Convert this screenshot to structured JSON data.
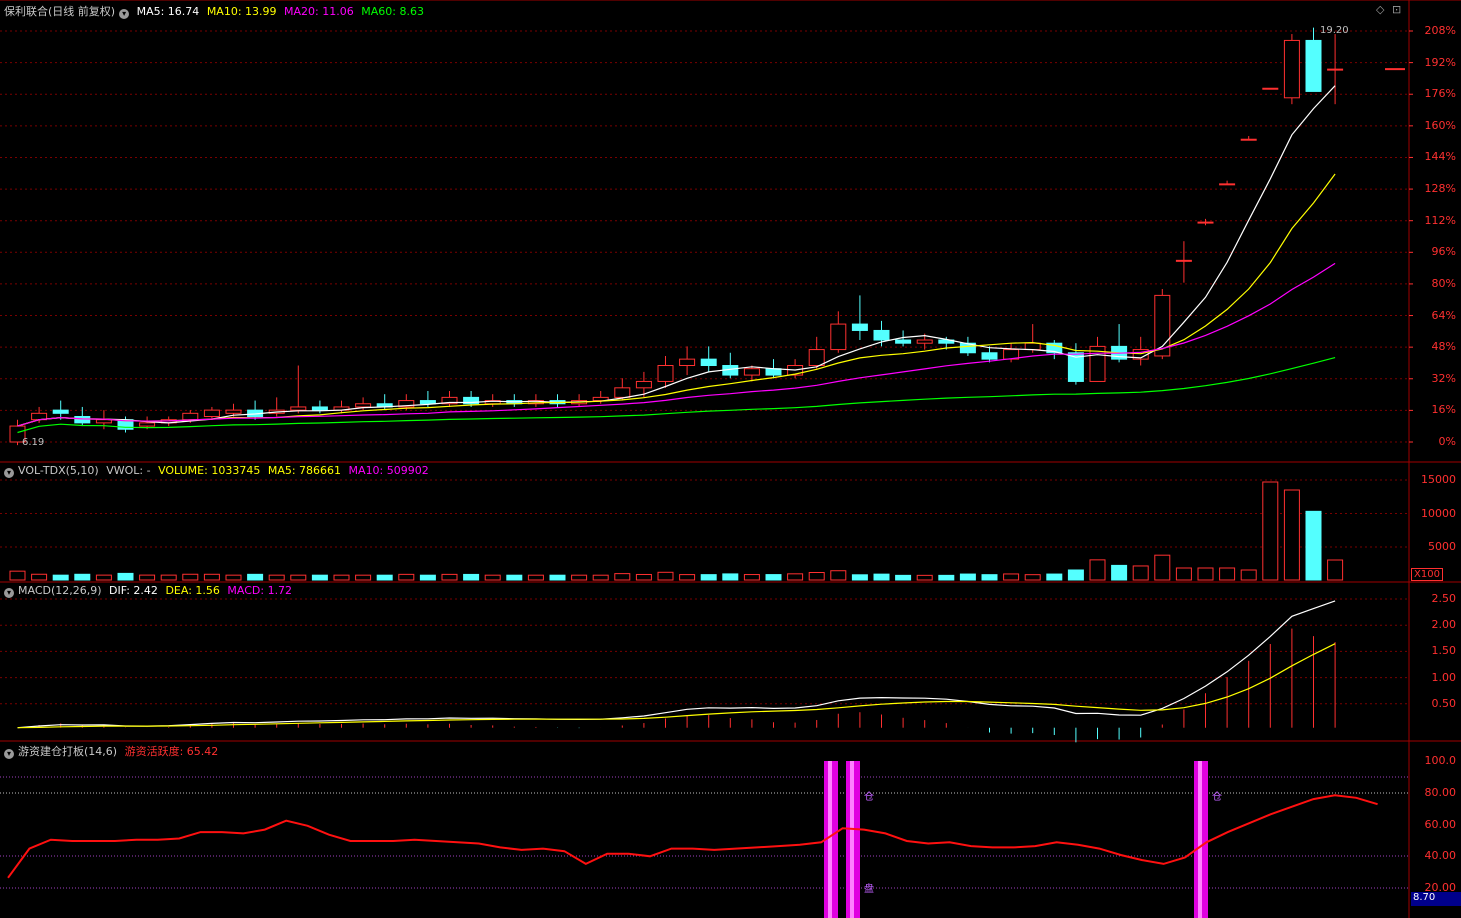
{
  "header": {
    "title": "保利联合(日线 前复权)",
    "ma_items": [
      {
        "label": "MA5: 16.74",
        "color": "#ffffff"
      },
      {
        "label": "MA10: 13.99",
        "color": "#ffff00"
      },
      {
        "label": "MA20: 11.06",
        "color": "#ff00ff"
      },
      {
        "label": "MA60: 8.63",
        "color": "#00ff00"
      }
    ],
    "ctl_icons": [
      "◇",
      "⊡"
    ]
  },
  "price_axis": [
    "208%",
    "192%",
    "176%",
    "160%",
    "144%",
    "128%",
    "112%",
    "96%",
    "80%",
    "64%",
    "48%",
    "32%",
    "16%",
    "0%"
  ],
  "price_marks": {
    "high": "19.20",
    "low": "6.19"
  },
  "volume": {
    "title": "VOL-TDX(5,10)",
    "vwol": "VWOL: -",
    "volume_label": "VOLUME: 1033745",
    "ma5_label": "MA5: 786661",
    "ma10_label": "MA10: 509902",
    "axis": [
      "15000",
      "10000",
      "5000"
    ],
    "unit": "X100"
  },
  "macd": {
    "title": "MACD(12,26,9)",
    "dif": "DIF: 2.42",
    "dea": "DEA: 1.56",
    "macd": "MACD: 1.72",
    "axis": [
      "2.50",
      "2.00",
      "1.50",
      "1.00",
      "0.50"
    ]
  },
  "indicator": {
    "title": "游资建仓打板(14,6)",
    "activity": "游资活跃度: 65.42",
    "axis": [
      "100.0",
      "80.00",
      "60.00",
      "40.00",
      "20.00"
    ],
    "box_value": "8.70",
    "tag1": "仓",
    "tag2": "盘"
  },
  "colors": {
    "up": "#ff3030",
    "down": "#54ffff",
    "grid": "#7a0000",
    "axis": "#ff3030"
  },
  "chart_data": {
    "type": "candlestick",
    "candles": [
      [
        6.2,
        6.9,
        6.7,
        6.1
      ],
      [
        6.9,
        7.3,
        7.1,
        6.8
      ],
      [
        7.2,
        7.5,
        7.1,
        6.9
      ],
      [
        7.0,
        7.3,
        6.8,
        6.7
      ],
      [
        6.8,
        7.2,
        6.9,
        6.6
      ],
      [
        6.9,
        7.0,
        6.6,
        6.5
      ],
      [
        6.7,
        7.0,
        6.8,
        6.6
      ],
      [
        6.8,
        7.0,
        6.9,
        6.7
      ],
      [
        6.9,
        7.2,
        7.1,
        6.8
      ],
      [
        7.0,
        7.3,
        7.2,
        6.9
      ],
      [
        7.1,
        7.4,
        7.2,
        7.0
      ],
      [
        7.2,
        7.5,
        7.0,
        6.9
      ],
      [
        7.1,
        7.6,
        7.2,
        7.0
      ],
      [
        7.2,
        8.6,
        7.3,
        7.1
      ],
      [
        7.3,
        7.5,
        7.2,
        7.1
      ],
      [
        7.2,
        7.5,
        7.3,
        7.1
      ],
      [
        7.3,
        7.6,
        7.4,
        7.2
      ],
      [
        7.4,
        7.7,
        7.3,
        7.2
      ],
      [
        7.3,
        7.7,
        7.5,
        7.2
      ],
      [
        7.5,
        7.8,
        7.4,
        7.3
      ],
      [
        7.4,
        7.8,
        7.6,
        7.3
      ],
      [
        7.6,
        7.8,
        7.4,
        7.3
      ],
      [
        7.4,
        7.7,
        7.5,
        7.3
      ],
      [
        7.5,
        7.7,
        7.4,
        7.3
      ],
      [
        7.4,
        7.7,
        7.5,
        7.3
      ],
      [
        7.5,
        7.7,
        7.4,
        7.3
      ],
      [
        7.4,
        7.7,
        7.5,
        7.3
      ],
      [
        7.5,
        7.8,
        7.6,
        7.4
      ],
      [
        7.6,
        8.2,
        7.9,
        7.5
      ],
      [
        7.9,
        8.4,
        8.1,
        7.6
      ],
      [
        8.1,
        8.9,
        8.6,
        7.9
      ],
      [
        8.6,
        9.2,
        8.8,
        8.3
      ],
      [
        8.8,
        9.2,
        8.6,
        8.4
      ],
      [
        8.6,
        9.0,
        8.3,
        8.2
      ],
      [
        8.3,
        8.6,
        8.5,
        8.1
      ],
      [
        8.5,
        8.8,
        8.3,
        8.2
      ],
      [
        8.3,
        8.8,
        8.6,
        8.2
      ],
      [
        8.6,
        9.5,
        9.1,
        8.5
      ],
      [
        9.1,
        10.3,
        9.9,
        9.0
      ],
      [
        9.9,
        10.8,
        9.7,
        9.4
      ],
      [
        9.7,
        10.0,
        9.4,
        9.2
      ],
      [
        9.4,
        9.7,
        9.3,
        9.2
      ],
      [
        9.3,
        9.6,
        9.4,
        9.1
      ],
      [
        9.4,
        9.5,
        9.3,
        9.1
      ],
      [
        9.3,
        9.5,
        9.0,
        8.9
      ],
      [
        9.0,
        9.2,
        8.8,
        8.7
      ],
      [
        8.8,
        9.3,
        9.1,
        8.7
      ],
      [
        9.1,
        9.9,
        9.3,
        9.0
      ],
      [
        9.3,
        9.4,
        9.0,
        8.8
      ],
      [
        9.0,
        9.3,
        8.1,
        8.0
      ],
      [
        8.1,
        9.5,
        9.2,
        8.1
      ],
      [
        9.2,
        9.9,
        8.8,
        8.7
      ],
      [
        8.8,
        9.5,
        9.1,
        8.6
      ],
      [
        8.9,
        11.0,
        10.8,
        8.8
      ],
      [
        11.9,
        12.5,
        11.9,
        11.2
      ],
      [
        13.1,
        13.2,
        13.1,
        13.0
      ],
      [
        14.3,
        14.4,
        14.3,
        14.3
      ],
      [
        15.7,
        15.8,
        15.7,
        15.7
      ],
      [
        17.3,
        17.3,
        17.3,
        17.3
      ],
      [
        17.0,
        19.0,
        18.8,
        16.8
      ],
      [
        18.8,
        19.2,
        17.2,
        17.2
      ],
      [
        17.9,
        19.0,
        17.9,
        16.8
      ]
    ],
    "ma_last": {
      "MA5": 16.74,
      "MA10": 13.99,
      "MA20": 11.06,
      "MA60": 8.63
    }
  }
}
